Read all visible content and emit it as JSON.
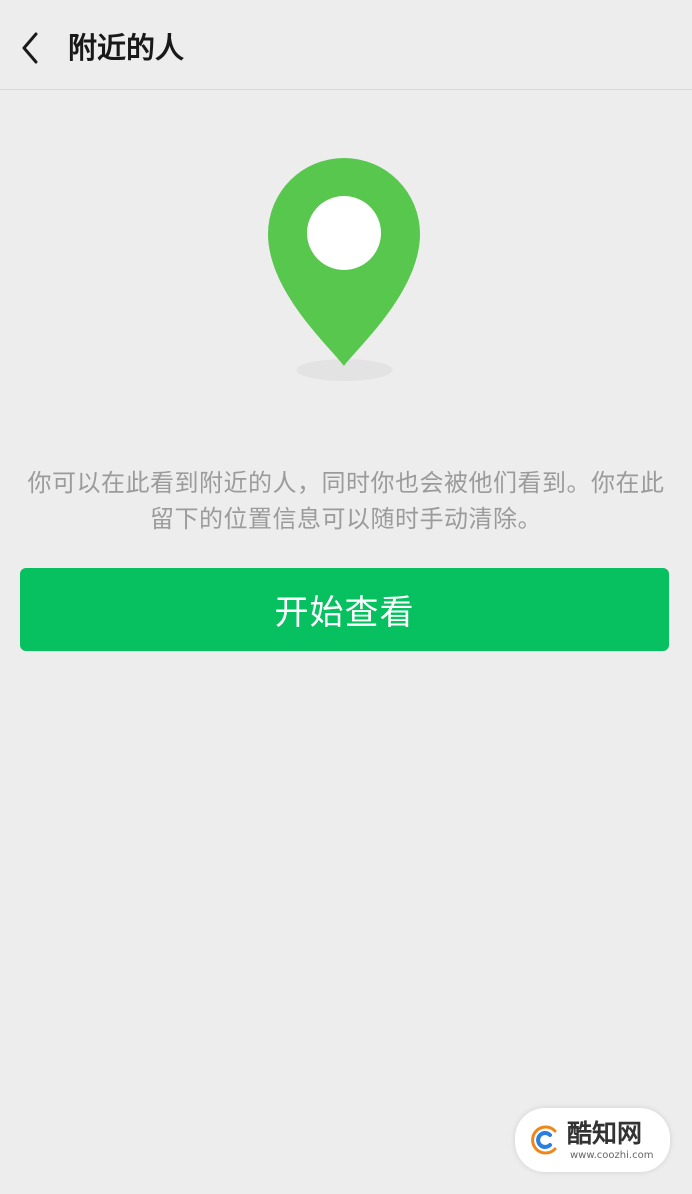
{
  "header": {
    "title": "附近的人",
    "back_icon": "chevron-left-icon"
  },
  "hero": {
    "icon": "location-pin-icon"
  },
  "description": "你可以在此看到附近的人，同时你也会被他们看到。你在此留下的位置信息可以随时手动清除。",
  "start_button": {
    "label": "开始查看"
  },
  "watermark": {
    "brand": "酷知网",
    "url": "www.coozhi.com",
    "logo_icon": "coozhi-logo-icon"
  },
  "colors": {
    "background": "#EDEDED",
    "pin": "#58C74E",
    "pin_hole": "#FFFFFF",
    "pin_shadow": "#E3E3E3",
    "button": "#07C160",
    "button_text": "#FFFFFF",
    "description_text": "#9B9B9B",
    "title_text": "#191919"
  }
}
